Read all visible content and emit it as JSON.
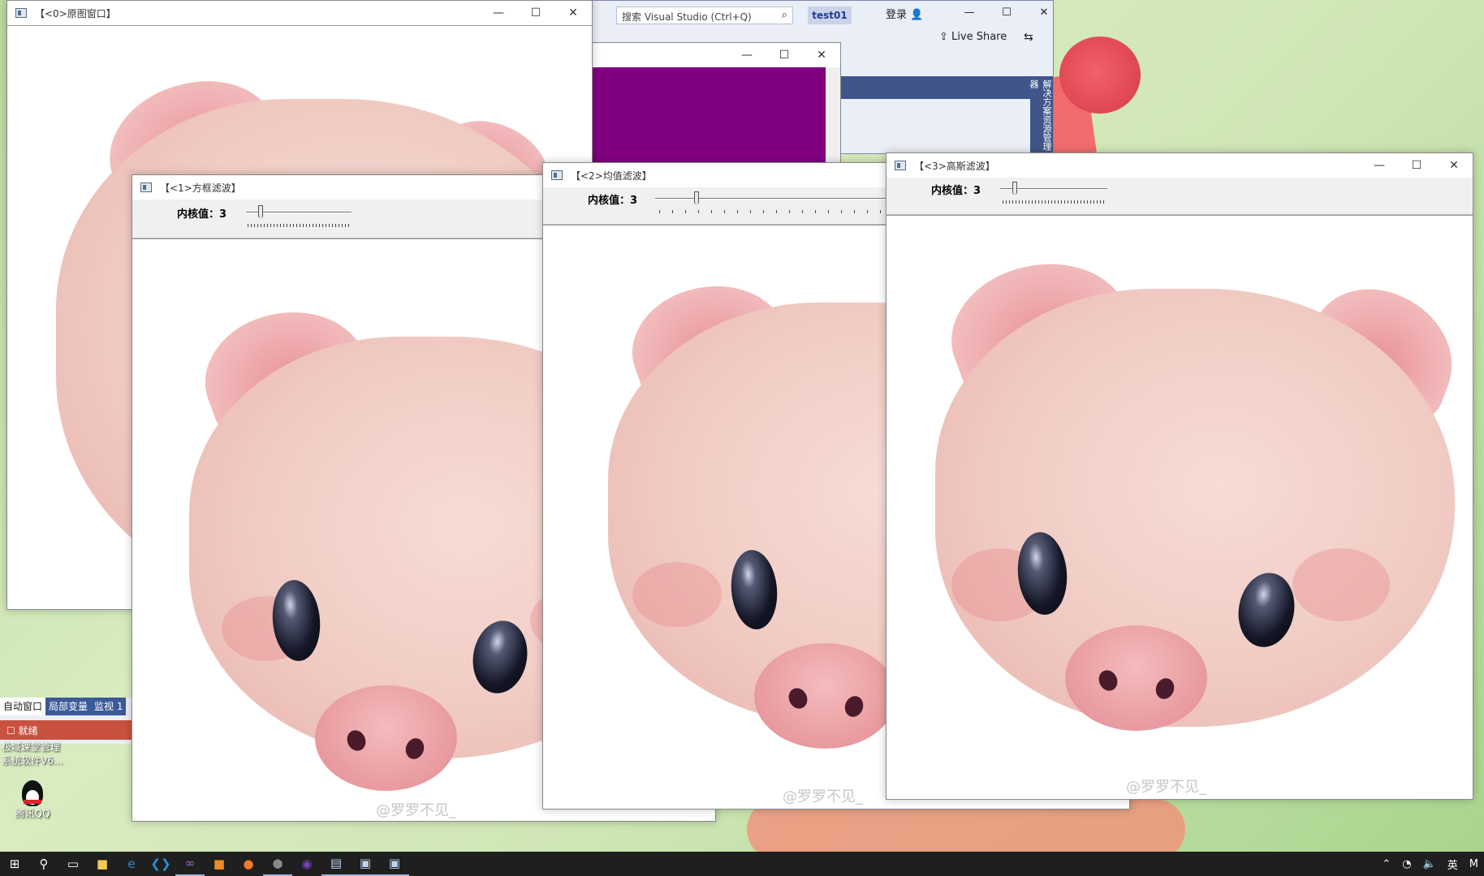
{
  "windows": {
    "original": {
      "title": "【<0>原图窗口】"
    },
    "box_filter": {
      "title": "【<1>方框滤波】",
      "label": "内核值：",
      "value": "3"
    },
    "mean_filter": {
      "title": "【<2>均值滤波】",
      "label": "内核值：",
      "value": "3"
    },
    "gaussian_filter": {
      "title": "【<3>高斯滤波】",
      "label": "内核值：",
      "value": "3"
    },
    "window_buttons": {
      "minimize": "—",
      "maximize": "☐",
      "close": "✕"
    }
  },
  "watermark": "@罗罗不见_",
  "visual_studio": {
    "search_placeholder": "搜索 Visual Studio (Ctrl+Q)",
    "project": "test01",
    "login": "登录",
    "live_share": "Live Share",
    "side_panel": "解决方案资源管理器",
    "edge_fragment": "l)"
  },
  "ide_panel": {
    "tabs": [
      "自动窗口",
      "局部变量",
      "监视 1"
    ],
    "status": "就绪"
  },
  "desktop": {
    "icon1_label_line1": "极域课堂管理",
    "icon1_label_line2": "系统软件V6...",
    "icon2_label": "腾讯QQ"
  },
  "taskbar": {
    "tray_ime": "英",
    "tray_m": "M"
  },
  "colors": {
    "console": "#800080",
    "vs_accent": "#40568a",
    "status_bar": "#c8523f"
  }
}
